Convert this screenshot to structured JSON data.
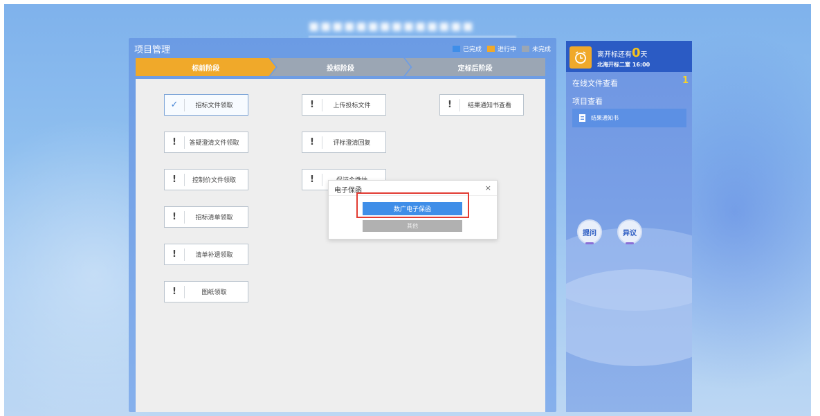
{
  "header": {
    "site_title": "■■■■■■■■■■■■■■"
  },
  "panel": {
    "title": "项目管理",
    "legend": [
      {
        "label": "已完成",
        "color": "#3f8ee8"
      },
      {
        "label": "进行中",
        "color": "#f0a92a"
      },
      {
        "label": "未完成",
        "color": "#9ba6b4"
      }
    ],
    "stages": [
      "标前阶段",
      "投标阶段",
      "定标后阶段"
    ]
  },
  "tasks": {
    "col1": [
      {
        "label": "招标文件领取",
        "status": "done",
        "icon": "check-icon"
      },
      {
        "label": "答疑澄清文件领取",
        "status": "pending",
        "icon": "exclamation-icon"
      },
      {
        "label": "控制价文件领取",
        "status": "pending",
        "icon": "exclamation-icon"
      },
      {
        "label": "招标清单领取",
        "status": "pending",
        "icon": "exclamation-icon"
      },
      {
        "label": "清单补遗领取",
        "status": "pending",
        "icon": "exclamation-icon"
      },
      {
        "label": "图纸领取",
        "status": "pending",
        "icon": "exclamation-icon"
      }
    ],
    "col2": [
      {
        "label": "上传投标文件",
        "status": "pending",
        "icon": "exclamation-icon"
      },
      {
        "label": "评标澄清回复",
        "status": "pending",
        "icon": "exclamation-icon"
      },
      {
        "label": "保证金缴纳",
        "status": "pending",
        "icon": "exclamation-icon"
      }
    ],
    "col3": [
      {
        "label": "结果通知书查看",
        "status": "pending",
        "icon": "exclamation-icon"
      }
    ]
  },
  "modal": {
    "title": "电子保函",
    "close": "×",
    "primary_button": "数广电子保函",
    "secondary_button": "其他"
  },
  "sidebar": {
    "countdown_prefix": "离开标还有",
    "countdown_days": "0",
    "countdown_unit": "天",
    "countdown_detail": "北海开标二室 16:00",
    "online_files_label": "在线文件查看",
    "online_files_count": "1",
    "project_view_label": "项目查看",
    "doc_item": "结果通知书",
    "ask_button": "提问",
    "objection_button": "异议"
  }
}
